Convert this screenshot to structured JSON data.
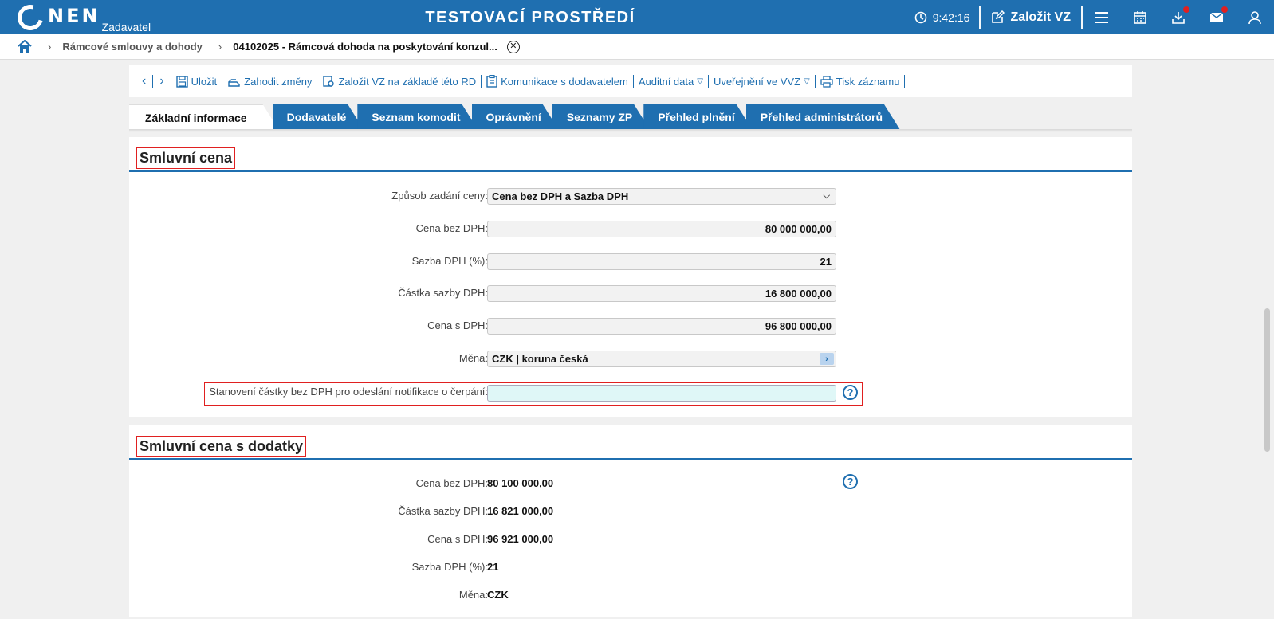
{
  "header": {
    "logo_text": "NEN",
    "logo_sub": "Zadavatel",
    "env_title": "TESTOVACÍ PROSTŘEDÍ",
    "time": "9:42:16",
    "create_label": "Založit VZ"
  },
  "breadcrumb": {
    "items": [
      "Rámcové smlouvy a dohody"
    ],
    "current": "04102025 - Rámcová dohoda na poskytování konzul..."
  },
  "toolbar": {
    "save": "Uložit",
    "discard": "Zahodit změny",
    "create_from": "Založit VZ na základě této RD",
    "communication": "Komunikace s dodavatelem",
    "audit": "Auditní data",
    "publish": "Uveřejnění ve VVZ",
    "print": "Tisk záznamu"
  },
  "tabs": [
    "Základní informace",
    "Dodavatelé",
    "Seznam komodit",
    "Oprávnění",
    "Seznamy ZP",
    "Přehled plnění",
    "Přehled administrátorů"
  ],
  "contract_price": {
    "title": "Smluvní cena",
    "fields": {
      "mode_label": "Způsob zadání ceny:",
      "mode_value": "Cena bez DPH a Sazba DPH",
      "price_ex_label": "Cena bez DPH:",
      "price_ex_value": "80 000 000,00",
      "vat_rate_label": "Sazba DPH (%):",
      "vat_rate_value": "21",
      "vat_amount_label": "Částka sazby DPH:",
      "vat_amount_value": "16 800 000,00",
      "price_inc_label": "Cena s DPH:",
      "price_inc_value": "96 800 000,00",
      "currency_label": "Měna:",
      "currency_value": "CZK | koruna česká",
      "notify_label": "Stanovení částky bez DPH pro odeslání notifikace o čerpání:",
      "notify_value": ""
    }
  },
  "contract_price_amendments": {
    "title": "Smluvní cena s dodatky",
    "fields": {
      "price_ex_label": "Cena bez DPH:",
      "price_ex_value": "80 100 000,00",
      "vat_amount_label": "Částka sazby DPH:",
      "vat_amount_value": "16 821 000,00",
      "price_inc_label": "Cena s DPH:",
      "price_inc_value": "96 921 000,00",
      "vat_rate_label": "Sazba DPH (%):",
      "vat_rate_value": "21",
      "currency_label": "Měna:",
      "currency_value": "CZK"
    }
  },
  "colors": {
    "brand": "#1f6fb0",
    "highlight_border": "#e02020",
    "notify_field_bg": "#dff7f7"
  }
}
